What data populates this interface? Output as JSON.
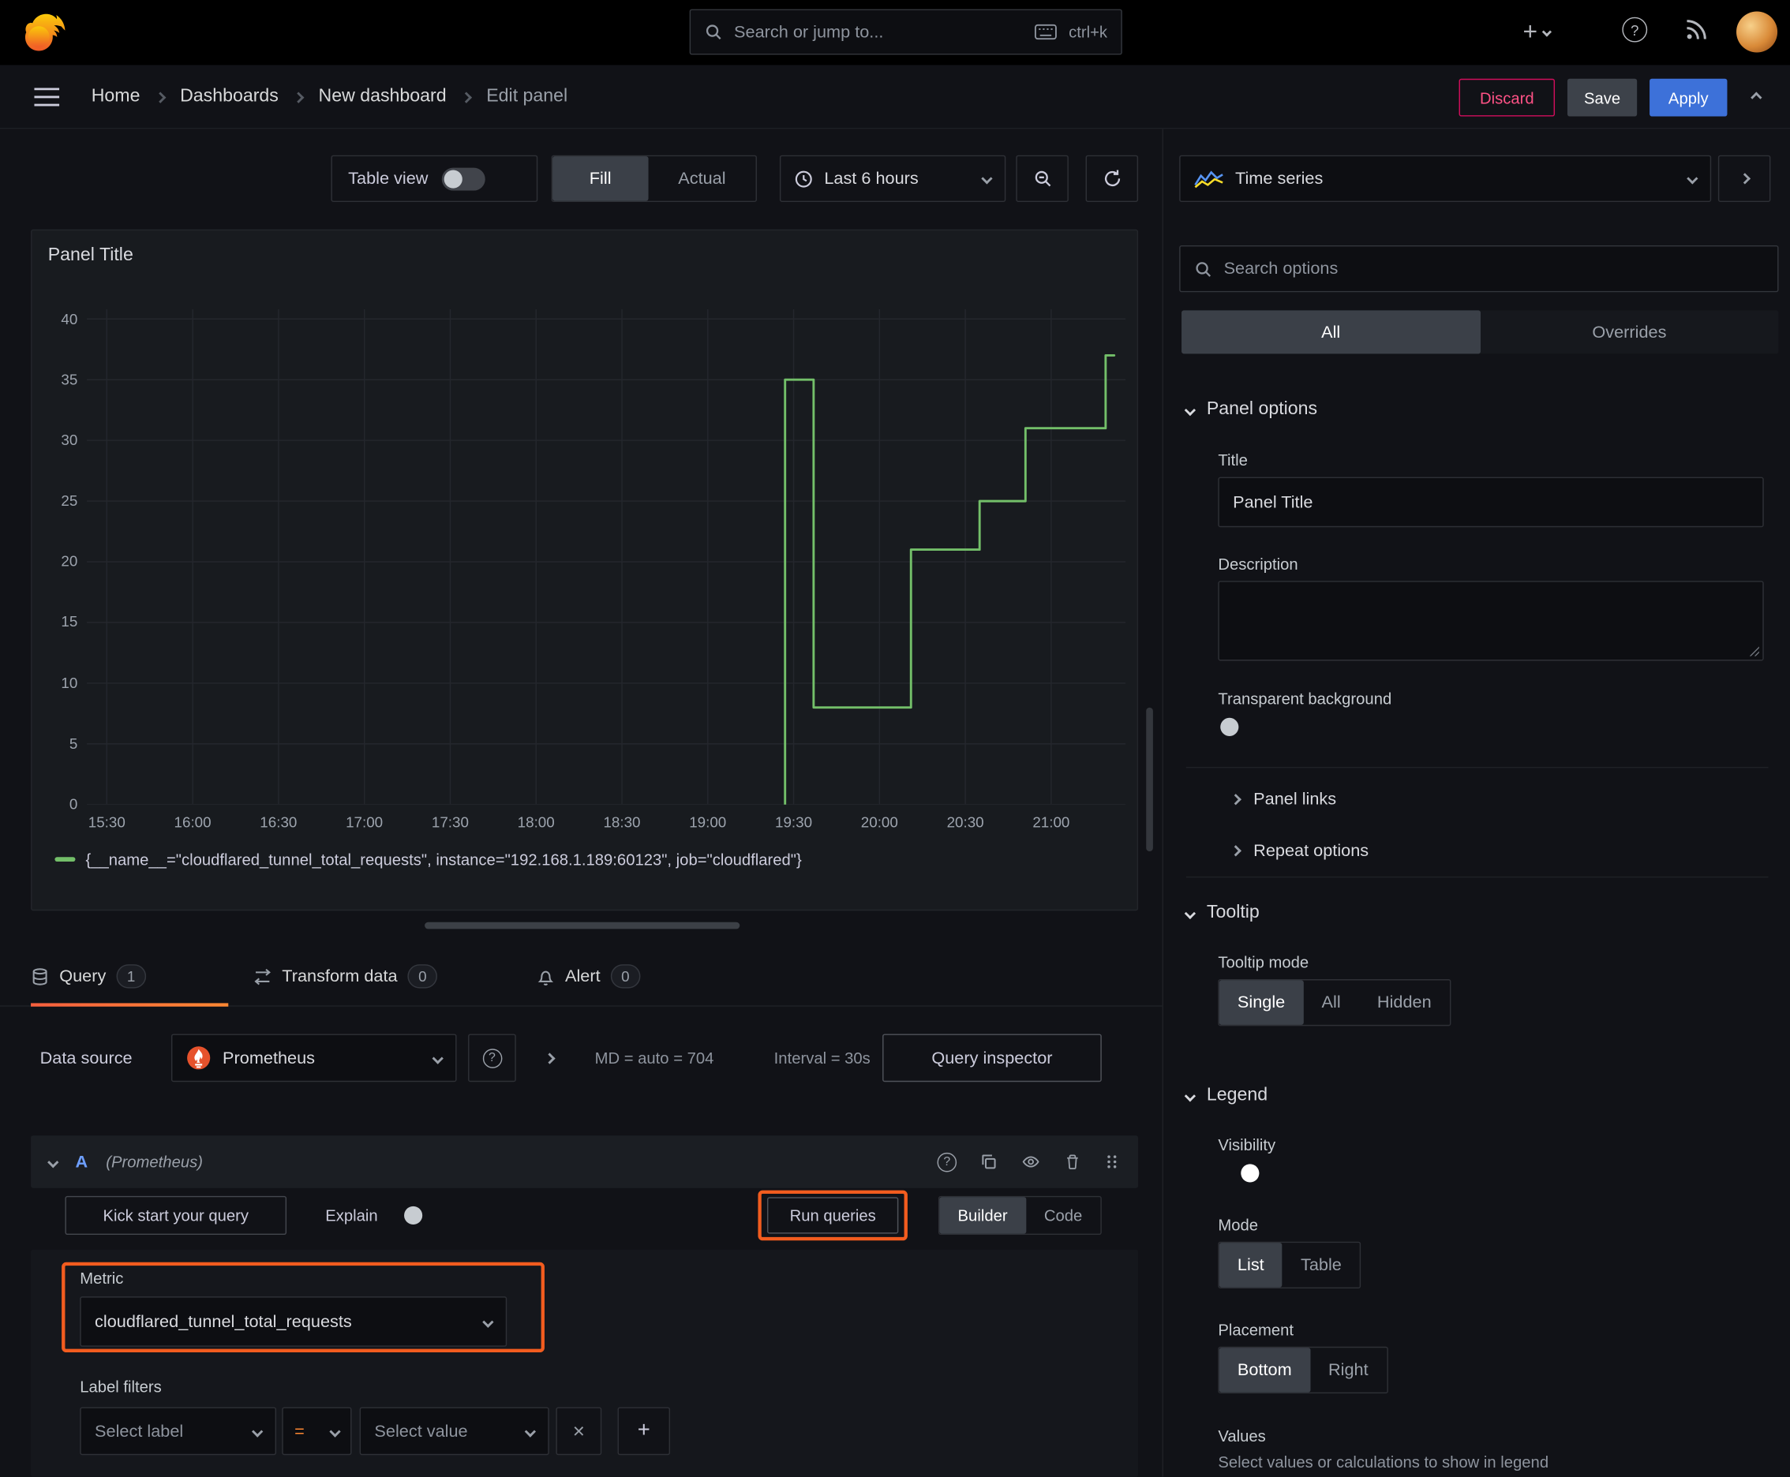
{
  "colors": {
    "background": "#111217",
    "panel": "#181b1f",
    "accent_orange": "#ff780a",
    "highlight_orange": "#f25c1f",
    "series_green": "#73bf69",
    "primary_blue": "#3d71d9",
    "danger_red": "#ff5286"
  },
  "icons": {
    "plus_glyph": "+",
    "help_glyph": "?",
    "close_glyph": "×"
  },
  "topbar": {
    "search_placeholder": "Search or jump to...",
    "search_shortcut": "ctrl+k"
  },
  "nav": {
    "breadcrumbs": [
      "Home",
      "Dashboards",
      "New dashboard",
      "Edit panel"
    ],
    "discard_label": "Discard",
    "save_label": "Save",
    "apply_label": "Apply"
  },
  "toolbar": {
    "table_view_label": "Table view",
    "fill_label": "Fill",
    "actual_label": "Actual",
    "time_range_label": "Last 6 hours"
  },
  "panel": {
    "title": "Panel Title",
    "legend_series": "{__name__=\"cloudflared_tunnel_total_requests\", instance=\"192.168.1.189:60123\", job=\"cloudflared\"}"
  },
  "chart_data": {
    "type": "line",
    "title": "Panel Title",
    "x_axis_note": "minutes after 15:30",
    "x_ticks": [
      "15:30",
      "16:00",
      "16:30",
      "17:00",
      "17:30",
      "18:00",
      "18:30",
      "19:00",
      "19:30",
      "20:00",
      "20:30",
      "21:00"
    ],
    "x_tick_minutes": [
      0,
      30,
      60,
      90,
      120,
      150,
      180,
      210,
      240,
      270,
      300,
      330
    ],
    "y_ticks": [
      0,
      5,
      10,
      15,
      20,
      25,
      30,
      35,
      40
    ],
    "ylim": [
      0,
      40.8
    ],
    "xlim_minutes": [
      -7,
      356
    ],
    "grid": true,
    "legend_position": "bottom",
    "series": [
      {
        "name": "{__name__=\"cloudflared_tunnel_total_requests\", instance=\"192.168.1.189:60123\", job=\"cloudflared\"}",
        "color": "#73bf69",
        "points": [
          [
            237,
            0
          ],
          [
            237,
            35
          ],
          [
            247,
            35
          ],
          [
            247,
            8
          ],
          [
            281,
            8
          ],
          [
            281,
            21
          ],
          [
            305,
            21
          ],
          [
            305,
            25
          ],
          [
            321,
            25
          ],
          [
            321,
            31
          ],
          [
            349,
            31
          ],
          [
            349,
            37
          ],
          [
            352,
            37
          ]
        ]
      }
    ]
  },
  "tabs": {
    "query_label": "Query",
    "query_count": "1",
    "transform_label": "Transform data",
    "transform_count": "0",
    "alert_label": "Alert",
    "alert_count": "0"
  },
  "query": {
    "data_source_label": "Data source",
    "data_source_value": "Prometheus",
    "max_data_points": "MD = auto = 704",
    "interval": "Interval = 30s",
    "query_inspector_label": "Query inspector",
    "ref_id": "A",
    "ref_id_note": "(Prometheus)",
    "kick_start_label": "Kick start your query",
    "explain_label": "Explain",
    "run_queries_label": "Run queries",
    "builder_label": "Builder",
    "code_label": "Code",
    "metric_label": "Metric",
    "metric_value": "cloudflared_tunnel_total_requests",
    "label_filters_label": "Label filters",
    "select_label_placeholder": "Select label",
    "operator_value": "=",
    "select_value_placeholder": "Select value"
  },
  "sidebar": {
    "viz_type": "Time series",
    "search_placeholder": "Search options",
    "tab_all": "All",
    "tab_overrides": "Overrides",
    "panel_options": {
      "header": "Panel options",
      "title_label": "Title",
      "title_value": "Panel Title",
      "description_label": "Description",
      "transparent_label": "Transparent background",
      "panel_links": "Panel links",
      "repeat_options": "Repeat options"
    },
    "tooltip": {
      "header": "Tooltip",
      "mode_label": "Tooltip mode",
      "options": [
        "Single",
        "All",
        "Hidden"
      ],
      "selected": "Single"
    },
    "legend": {
      "header": "Legend",
      "visibility_label": "Visibility",
      "mode_label": "Mode",
      "mode_options": [
        "List",
        "Table"
      ],
      "mode_selected": "List",
      "placement_label": "Placement",
      "placement_options": [
        "Bottom",
        "Right"
      ],
      "placement_selected": "Bottom",
      "values_label": "Values",
      "values_help": "Select values or calculations to show in legend"
    }
  }
}
